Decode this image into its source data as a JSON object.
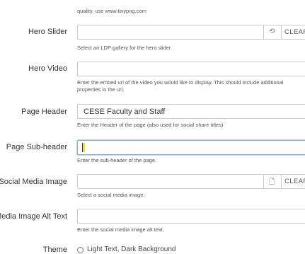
{
  "top_help": "quality, use www.tinypng.com",
  "hero_slider": {
    "label": "Hero Slider",
    "value": "",
    "help": "Select an LDP gallery for the hero slider.",
    "clear_label": "CLEAR"
  },
  "hero_video": {
    "label": "Hero Video",
    "value": "",
    "help": "Enter the embed url of the video you would like to display. This should include additional properties in the url."
  },
  "page_header": {
    "label": "Page Header",
    "value": "CESE Faculty and Staff",
    "help": "Enter the Header of the page (also used for social share titles)"
  },
  "page_subheader": {
    "label": "Page Sub-header",
    "value": "",
    "help": "Enter the sub-header of the page."
  },
  "social_media_image": {
    "label": "Social Media Image",
    "value": "",
    "help": "Select a social media image.",
    "clear_label": "CLEAR"
  },
  "social_media_alt": {
    "label": "Media Image Alt Text",
    "value": "",
    "help": "Enter the social media image alt text."
  },
  "theme": {
    "label": "Theme",
    "options": [
      "Light Text, Dark Background"
    ]
  }
}
